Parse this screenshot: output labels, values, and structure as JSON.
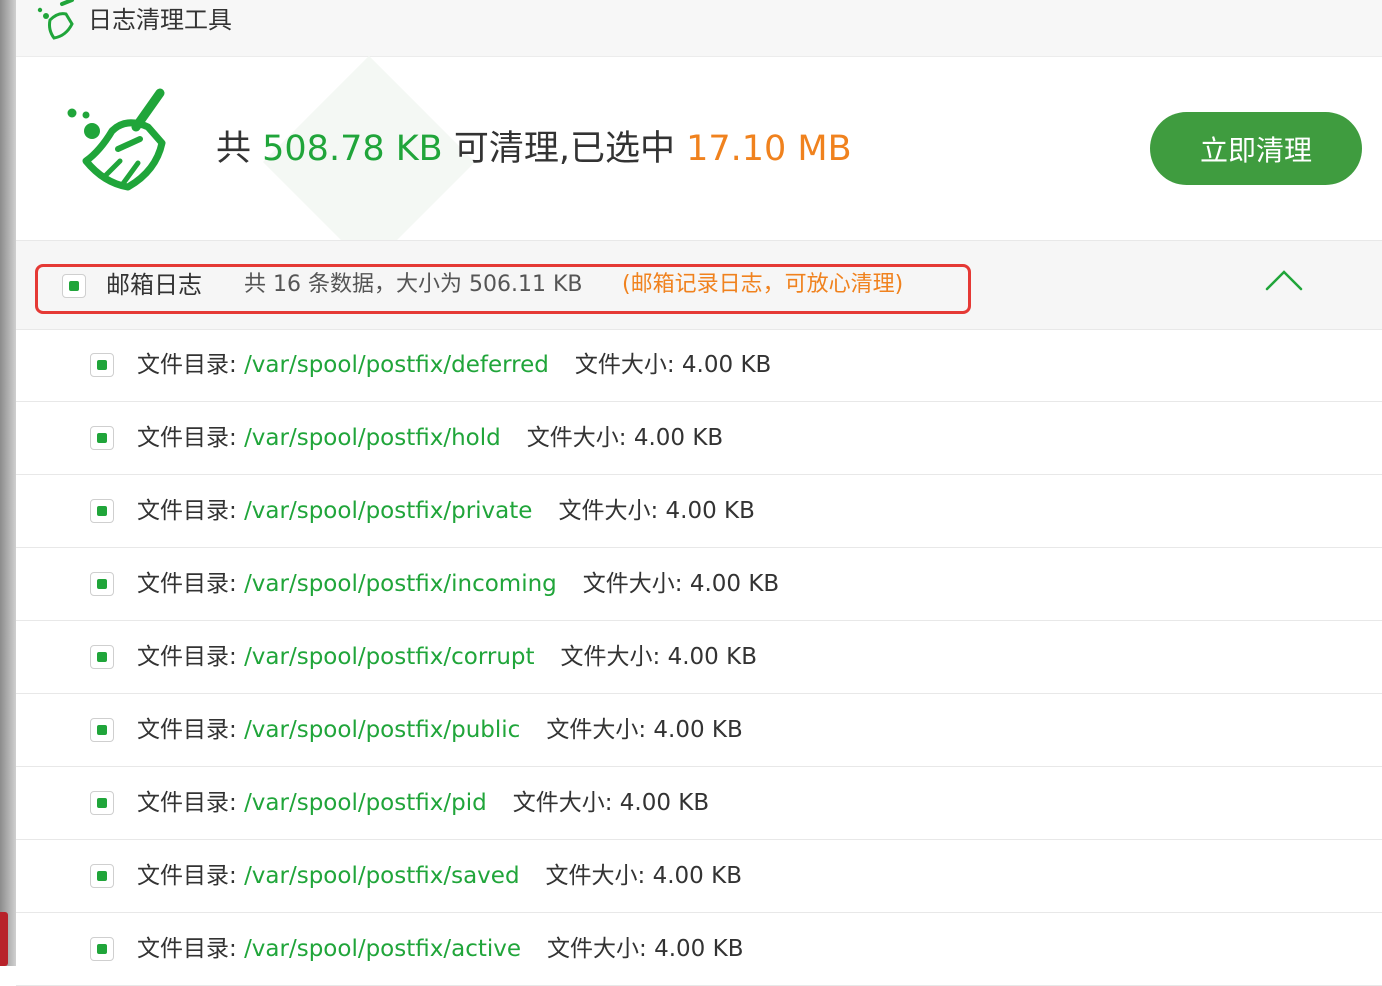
{
  "window": {
    "title": "日志清理工具"
  },
  "summary": {
    "prefix": "共 ",
    "total_size": "508.78 KB",
    "middle": " 可清理,已选中 ",
    "selected_size": "17.10 MB",
    "clean_button_label": "立即清理"
  },
  "group": {
    "name": "邮箱日志",
    "info": "共 16 条数据，大小为 506.11 KB",
    "note": "(邮箱记录日志，可放心清理)",
    "checked": true
  },
  "row_labels": {
    "dir_label": "文件目录: ",
    "size_label": "文件大小: "
  },
  "files": [
    {
      "path": "/var/spool/postfix/deferred",
      "size": "4.00 KB"
    },
    {
      "path": "/var/spool/postfix/hold",
      "size": "4.00 KB"
    },
    {
      "path": "/var/spool/postfix/private",
      "size": "4.00 KB"
    },
    {
      "path": "/var/spool/postfix/incoming",
      "size": "4.00 KB"
    },
    {
      "path": "/var/spool/postfix/corrupt",
      "size": "4.00 KB"
    },
    {
      "path": "/var/spool/postfix/public",
      "size": "4.00 KB"
    },
    {
      "path": "/var/spool/postfix/pid",
      "size": "4.00 KB"
    },
    {
      "path": "/var/spool/postfix/saved",
      "size": "4.00 KB"
    },
    {
      "path": "/var/spool/postfix/active",
      "size": "4.00 KB"
    }
  ],
  "colors": {
    "accent_green": "#20a53a",
    "button_green": "#3f9c3f",
    "highlight_orange": "#f0821e",
    "annotation_red": "#e53935"
  },
  "icons": {
    "title": "broom-icon",
    "summary": "broom-icon",
    "collapse": "chevron-up-icon",
    "checkbox": "checkbox-checked-icon"
  }
}
